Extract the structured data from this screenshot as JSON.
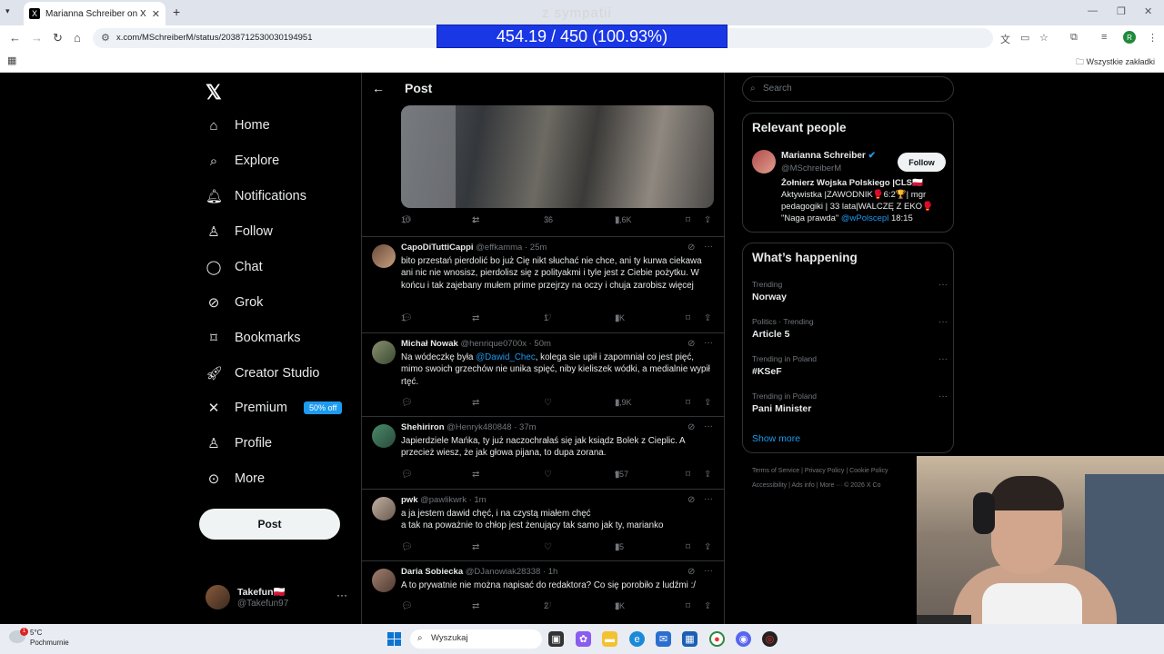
{
  "browser": {
    "tab_title": "Marianna Schreiber on X: \"A kto",
    "url": "x.com/MSchreiberM/status/2038712530030194951",
    "bookmarks_all": "Wszystkie zakładki",
    "profile_initial": "R"
  },
  "overlay": {
    "top_text": "z sympatii",
    "counter": "454.19 / 450 (100.93%)"
  },
  "nav": {
    "items": [
      {
        "label": "Home",
        "icon": "home-icon"
      },
      {
        "label": "Explore",
        "icon": "search-icon"
      },
      {
        "label": "Notifications",
        "icon": "bell-icon"
      },
      {
        "label": "Follow",
        "icon": "person-add-icon"
      },
      {
        "label": "Chat",
        "icon": "chat-icon"
      },
      {
        "label": "Grok",
        "icon": "grok-icon"
      },
      {
        "label": "Bookmarks",
        "icon": "bookmark-icon"
      },
      {
        "label": "Creator Studio",
        "icon": "rocket-icon"
      },
      {
        "label": "Premium",
        "icon": "x-icon"
      },
      {
        "label": "Profile",
        "icon": "person-icon"
      },
      {
        "label": "More",
        "icon": "more-circle-icon"
      }
    ],
    "premium_badge": "50% off",
    "post_button": "Post",
    "account": {
      "name": "Takefun🇵🇱",
      "handle": "@Takefun97"
    }
  },
  "center": {
    "header_title": "Post",
    "main_post_stats": {
      "replies": "10",
      "reposts": "1",
      "likes": "36",
      "views": "7,6K"
    },
    "replies": [
      {
        "name": "CapoDiTuttiCappi",
        "handle": "@effkamma",
        "time": "· 25m",
        "text": "bito przestań pierdolić bo już Cię nikt słuchać nie chce, ani ty kurwa ciekawa ani nic nie wnosisz, pierdolisz się z polityakmi i tyle jest z Ciebie pożytku. W końcu i tak zajebany mułem prime przejrzy na oczy i chuja zarobisz więcej",
        "replies": "1",
        "reposts": "",
        "likes": "1",
        "views": "1K"
      },
      {
        "name": "Michał Nowak",
        "handle": "@henrique0700x",
        "time": "· 50m",
        "text_before": "Na wódeczkę była ",
        "mention": "@Dawid_Chec",
        "text_after": ", kolega sie upił i zapomniał co jest pięć, mimo swoich grzechów nie unika spięć, niby kieliszek wódki, a medialnie wypił rtęć.",
        "replies": "",
        "reposts": "",
        "likes": "",
        "views": "1,9K"
      },
      {
        "name": "Shehiriron",
        "handle": "@Henryk480848",
        "time": "· 37m",
        "text": "Japierdziele Mańka, ty już naczochrałaś się jak ksiądz Bolek z Cieplic. A przecież wiesz, że jak głowa pijana, to dupa zorana.",
        "replies": "",
        "reposts": "",
        "likes": "",
        "views": "957"
      },
      {
        "name": "pwk",
        "handle": "@pawlikwrk",
        "time": "· 1m",
        "text_line1": "a ja jestem dawid chęć, i na czystą miałem chęć",
        "text_line2": "a tak na poważnie to chłop jest żenujący tak samo jak ty, marianko",
        "replies": "",
        "reposts": "",
        "likes": "",
        "views": "15"
      },
      {
        "name": "Daria Sobiecka",
        "handle": "@DJanowiak28338",
        "time": "· 1h",
        "text": "A to prywatnie nie można napisać do redaktora? Co się porobiło z ludźmi :/",
        "replies": "",
        "reposts": "",
        "likes": "2",
        "views": "2K"
      }
    ]
  },
  "right": {
    "search_placeholder": "Search",
    "relevant_title": "Relevant people",
    "person": {
      "name": "Marianna Schreiber",
      "handle": "@MSchreiberM",
      "follow": "Follow",
      "bio_line1": "Żołnierz Wojska Polskiego |CLS🇵🇱",
      "bio_line2": "Aktywistka |ZAWODNIK🥊6:2🏆| mgr",
      "bio_line3": "pedagogiki | 33 lata|WALCZĘ Z EKO🥊",
      "bio_line4_text": "\"Naga prawda\" ",
      "bio_mention": "@wPolscepl",
      "bio_time": " 18:15"
    },
    "happening_title": "What’s happening",
    "trends": [
      {
        "category": "Trending",
        "name": "Norway"
      },
      {
        "category": "Politics · Trending",
        "name": "Article 5"
      },
      {
        "category": "Trending in Poland",
        "name": "#KSeF"
      },
      {
        "category": "Trending in Poland",
        "name": "Pani Minister"
      }
    ],
    "show_more": "Show more",
    "footer_line1": "Terms of Service   |   Privacy Policy   |   Cookie Policy",
    "footer_line2": "Accessibility   |   Ads info   |   More ···   © 2026 X Co"
  },
  "taskbar": {
    "temperature": "5°C",
    "condition": "Pochmurnie",
    "notif_count": "1",
    "search_placeholder": "Wyszukaj"
  },
  "colors": {
    "accent": "#1d9bf0",
    "counter_bg": "#1a37e6",
    "background": "#000000"
  }
}
